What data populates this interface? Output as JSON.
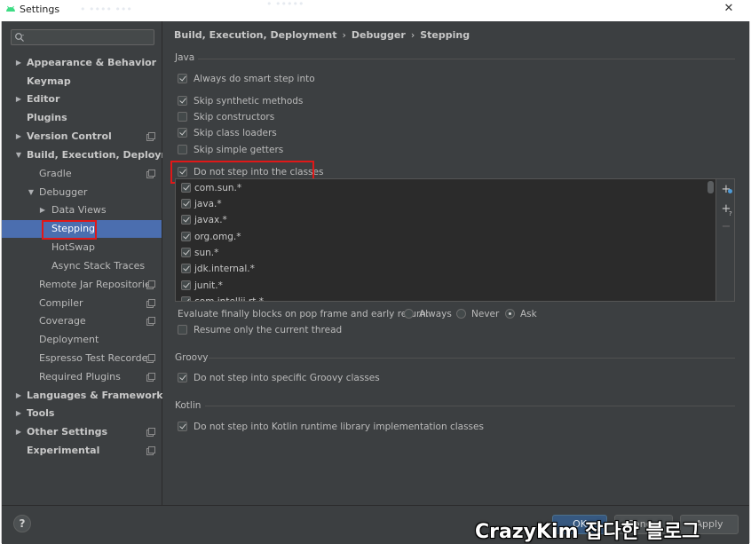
{
  "window": {
    "title": "Settings",
    "ghost_text": "• •••• •••",
    "ghost_text2": "• •••••",
    "close_glyph": "✕"
  },
  "sidebar": {
    "search_placeholder": "",
    "items": [
      {
        "label": "Appearance & Behavior"
      },
      {
        "label": "Keymap"
      },
      {
        "label": "Editor"
      },
      {
        "label": "Plugins"
      },
      {
        "label": "Version Control"
      },
      {
        "label": "Build, Execution, Deployment"
      },
      {
        "label": "Gradle"
      },
      {
        "label": "Debugger"
      },
      {
        "label": "Data Views"
      },
      {
        "label": "Stepping"
      },
      {
        "label": "HotSwap"
      },
      {
        "label": "Async Stack Traces"
      },
      {
        "label": "Remote Jar Repositories"
      },
      {
        "label": "Compiler"
      },
      {
        "label": "Coverage"
      },
      {
        "label": "Deployment"
      },
      {
        "label": "Espresso Test Recorder"
      },
      {
        "label": "Required Plugins"
      },
      {
        "label": "Languages & Frameworks"
      },
      {
        "label": "Tools"
      },
      {
        "label": "Other Settings"
      },
      {
        "label": "Experimental"
      }
    ]
  },
  "breadcrumb": {
    "part1": "Build, Execution, Deployment",
    "part2": "Debugger",
    "part3": "Stepping",
    "separator": "›"
  },
  "java": {
    "section_title": "Java",
    "always_smart_step": {
      "label": "Always do smart step into",
      "checked": true
    },
    "skip_synthetic": {
      "label": "Skip synthetic methods",
      "checked": true
    },
    "skip_constructors": {
      "label": "Skip constructors",
      "checked": false
    },
    "skip_class_loaders": {
      "label": "Skip class loaders",
      "checked": true
    },
    "skip_simple_getters": {
      "label": "Skip simple getters",
      "checked": false
    },
    "do_not_step_classes": {
      "label": "Do not step into the classes",
      "checked": true
    },
    "class_filters": [
      "com.sun.*",
      "java.*",
      "javax.*",
      "org.omg.*",
      "sun.*",
      "jdk.internal.*",
      "junit.*",
      "com.intellij.rt.*"
    ],
    "list_tools": {
      "add": "+",
      "add_pattern": "+",
      "remove": "−"
    },
    "evaluate_finally_label": "Evaluate finally blocks on pop frame and early return:",
    "evaluate_options": {
      "always": "Always",
      "never": "Never",
      "ask": "Ask",
      "selected": "Ask"
    },
    "resume_only_current": {
      "label": "Resume only the current thread",
      "checked": false
    }
  },
  "groovy": {
    "section_title": "Groovy",
    "do_not_step_groovy": {
      "label": "Do not step into specific Groovy classes",
      "checked": true
    }
  },
  "kotlin": {
    "section_title": "Kotlin",
    "do_not_step_kotlin": {
      "label": "Do not step into Kotlin runtime library implementation classes",
      "checked": true
    }
  },
  "footer": {
    "help_label": "?",
    "ok_label": "OK",
    "cancel_label": "Cancel",
    "apply_label": "Apply"
  },
  "watermark": {
    "text": "CrazyKim 잡다한 블로그"
  },
  "colors": {
    "background": "#3c3f41",
    "selection": "#4b6eaf",
    "highlight_box": "#e01818",
    "ok_button": "#365880"
  }
}
